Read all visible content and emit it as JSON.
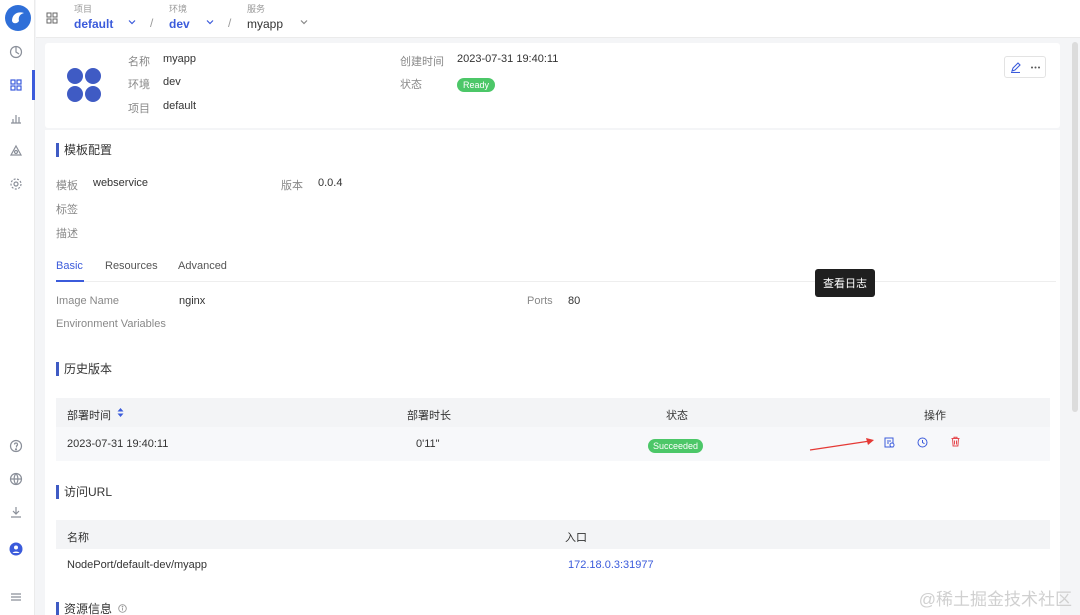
{
  "breadcrumb": {
    "project": {
      "label": "项目",
      "value": "default"
    },
    "environment": {
      "label": "环境",
      "value": "dev"
    },
    "service": {
      "label": "服务",
      "value": "myapp"
    },
    "separator": "/"
  },
  "header": {
    "name_label": "名称",
    "name": "myapp",
    "env_label": "环境",
    "env": "dev",
    "project_label": "项目",
    "project": "default",
    "created_label": "创建时间",
    "created": "2023-07-31 19:40:11",
    "status_label": "状态",
    "status": "Ready"
  },
  "template_config": {
    "title": "模板配置",
    "template_label": "模板",
    "template": "webservice",
    "version_label": "版本",
    "version": "0.0.4",
    "tags_label": "标签",
    "desc_label": "描述"
  },
  "tabs": [
    "Basic",
    "Resources",
    "Advanced"
  ],
  "basic": {
    "image_label": "Image Name",
    "image": "nginx",
    "ports_label": "Ports",
    "ports": "80",
    "env_vars_label": "Environment Variables"
  },
  "history": {
    "title": "历史版本",
    "columns": [
      "部署时间",
      "部署时长",
      "状态",
      "操作"
    ],
    "rows": [
      {
        "time": "2023-07-31 19:40:11",
        "duration": "0'11\"",
        "status": "Succeeded"
      }
    ],
    "tooltip": "查看日志"
  },
  "access_url": {
    "title": "访问URL",
    "columns": [
      "名称",
      "入口"
    ],
    "rows": [
      {
        "name": "NodePort/default-dev/myapp",
        "entry": "172.18.0.3:31977"
      }
    ]
  },
  "resource_info": {
    "title": "资源信息"
  },
  "watermark": "@稀土掘金技术社区",
  "colors": {
    "accent": "#3b5bdb",
    "success": "#4cc768",
    "danger": "#e5484d"
  }
}
